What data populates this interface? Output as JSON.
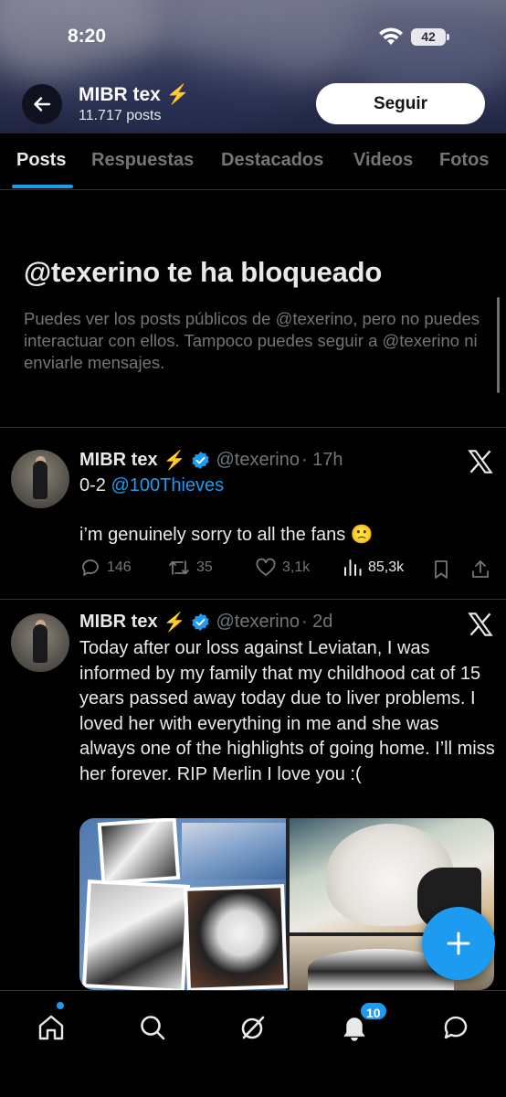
{
  "status_bar": {
    "time": "8:20",
    "battery": "42"
  },
  "header": {
    "name": "MIBR tex",
    "name_emoji": "⚡",
    "post_count": "11.717 posts",
    "follow_label": "Seguir"
  },
  "tabs": [
    {
      "label": "Posts",
      "active": true
    },
    {
      "label": "Respuestas",
      "active": false
    },
    {
      "label": "Destacados",
      "active": false
    },
    {
      "label": "Videos",
      "active": false
    },
    {
      "label": "Fotos",
      "active": false
    }
  ],
  "blocked": {
    "title": "@texerino te ha bloqueado",
    "description": "Puedes ver los posts públicos de @texerino, pero no puedes interactuar con ellos. Tampoco puedes seguir a @texerino ni enviarle mensajes."
  },
  "posts": [
    {
      "name": "MIBR tex",
      "emoji": "⚡",
      "handle": "@texerino",
      "time": "· 17h",
      "text_prefix": "0-2 ",
      "mention": "@100Thieves",
      "text_body": "i’m genuinely sorry to all the fans 🙁",
      "replies": "146",
      "reposts": "35",
      "likes": "3,1k",
      "views": "85,3k"
    },
    {
      "name": "MIBR tex",
      "emoji": "⚡",
      "handle": "@texerino",
      "time": "· 2d",
      "text": "Today after our loss against Leviatan, I was informed by my family that my childhood cat of 15 years passed away today due to liver problems. I loved her with everything in me and she was always one of the highlights of going home. I’ll miss her forever. RIP Merlin I love you :("
    }
  ],
  "bottom_nav": {
    "notifications_badge": "10"
  },
  "colors": {
    "accent": "#1d9bf0",
    "background": "#000000",
    "secondary_text": "#71767b",
    "primary_text": "#e7e9ea"
  }
}
